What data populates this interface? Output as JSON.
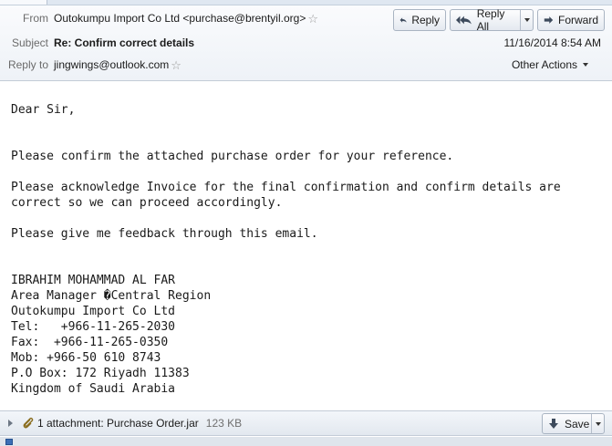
{
  "header": {
    "from_label": "From",
    "from_value": "Outokumpu Import Co Ltd <purchase@brentyil.org>",
    "subject_label": "Subject",
    "subject_value": "Re: Confirm correct details",
    "replyto_label": "Reply to",
    "replyto_value": "jingwings@outlook.com",
    "date": "11/16/2014 8:54 AM",
    "other_actions": "Other Actions"
  },
  "toolbar": {
    "reply_label": "Reply",
    "reply_all_label": "Reply All",
    "forward_label": "Forward"
  },
  "body": {
    "text": "Dear Sir,\n\n\nPlease confirm the attached purchase order for your reference.\n\nPlease acknowledge Invoice for the final confirmation and confirm details are\ncorrect so we can proceed accordingly.\n\nPlease give me feedback through this email.\n\n\nIBRAHIM MOHAMMAD AL FAR\nArea Manager �Central Region\nOutokumpu Import Co Ltd\nTel:   +966-11-265-2030\nFax:  +966-11-265-0350\nMob: +966-50 610 8743\nP.O Box: 172 Riyadh 11383\nKingdom of Saudi Arabia"
  },
  "attachment": {
    "text": "1 attachment: Purchase Order.jar",
    "size": "123 KB",
    "save_label": "Save"
  },
  "icons": {
    "reply": "reply-arrow-icon",
    "reply_all": "reply-all-arrow-icon",
    "forward": "forward-arrow-icon",
    "star": "star-outline-icon",
    "paperclip": "paperclip-icon",
    "save": "download-arrow-icon"
  }
}
